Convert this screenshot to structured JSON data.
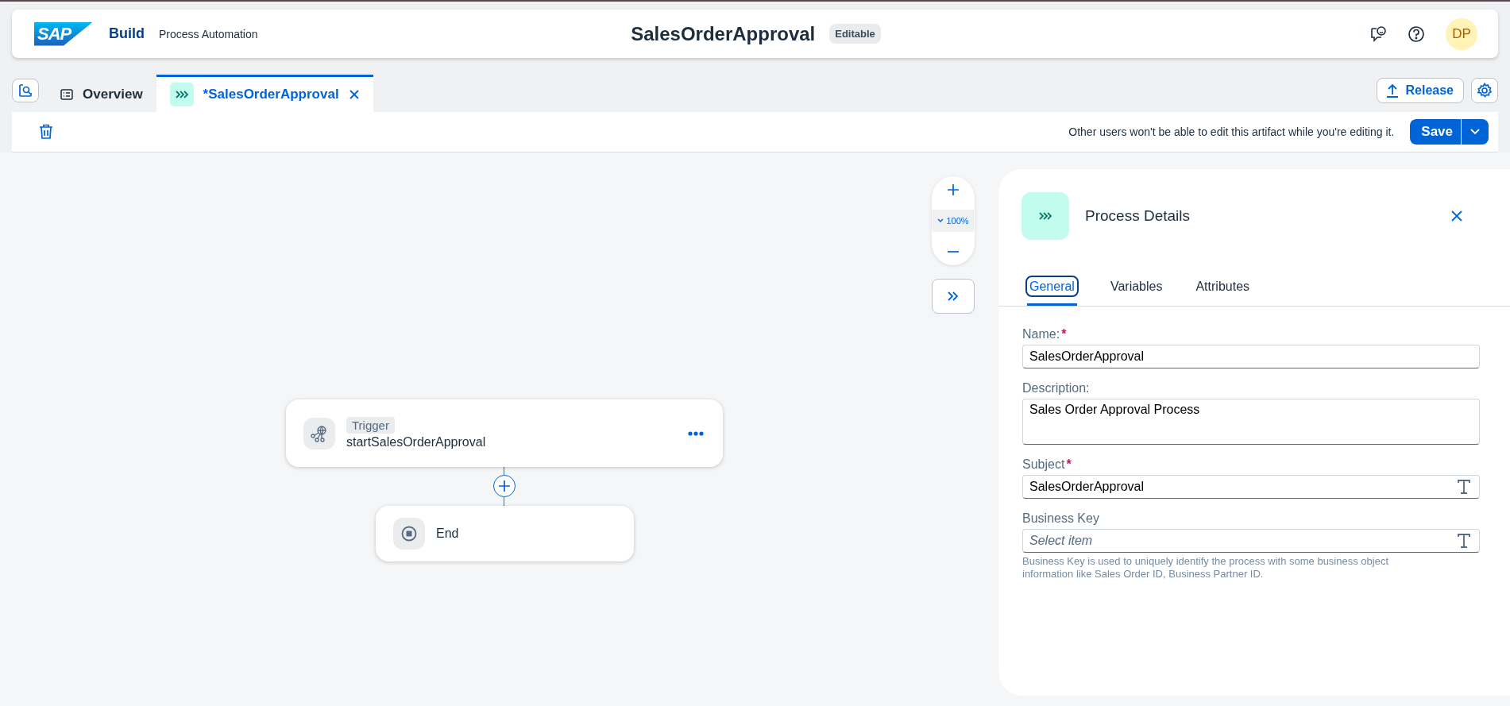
{
  "header": {
    "logo": "SAP",
    "product": "Build",
    "subtitle": "Process Automation",
    "title": "SalesOrderApproval",
    "badge": "Editable",
    "avatar": "DP"
  },
  "tabs": [
    {
      "kind": "overview",
      "label": "Overview",
      "selected": false
    },
    {
      "kind": "process",
      "label": "*SalesOrderApproval",
      "selected": true
    }
  ],
  "actions": {
    "release": "Release"
  },
  "toolbar": {
    "message": "Other users won't be able to edit this artifact while you're editing it.",
    "save": "Save"
  },
  "canvas": {
    "zoom": "100%",
    "nodes": [
      {
        "kind": "trigger",
        "tag": "Trigger",
        "label": "startSalesOrderApproval"
      },
      {
        "kind": "end",
        "label": "End"
      }
    ]
  },
  "panel": {
    "title": "Process Details",
    "required_mark": "*",
    "tabs": [
      {
        "label": "General",
        "selected": true
      },
      {
        "label": "Variables",
        "selected": false
      },
      {
        "label": "Attributes",
        "selected": false
      }
    ],
    "fields": [
      {
        "kind": "input",
        "label": "Name:",
        "required": true,
        "value": "SalesOrderApproval"
      },
      {
        "kind": "textarea",
        "label": "Description:",
        "required": false,
        "value": "Sales Order Approval Process"
      },
      {
        "kind": "expression",
        "label": "Subject",
        "required": true,
        "value": "SalesOrderApproval"
      },
      {
        "kind": "expression",
        "label": "Business Key",
        "required": false,
        "placeholder": "Select item",
        "hint": "Business Key is used to uniquely identify the process with some business object information like Sales Order ID, Business Partner ID."
      }
    ]
  }
}
